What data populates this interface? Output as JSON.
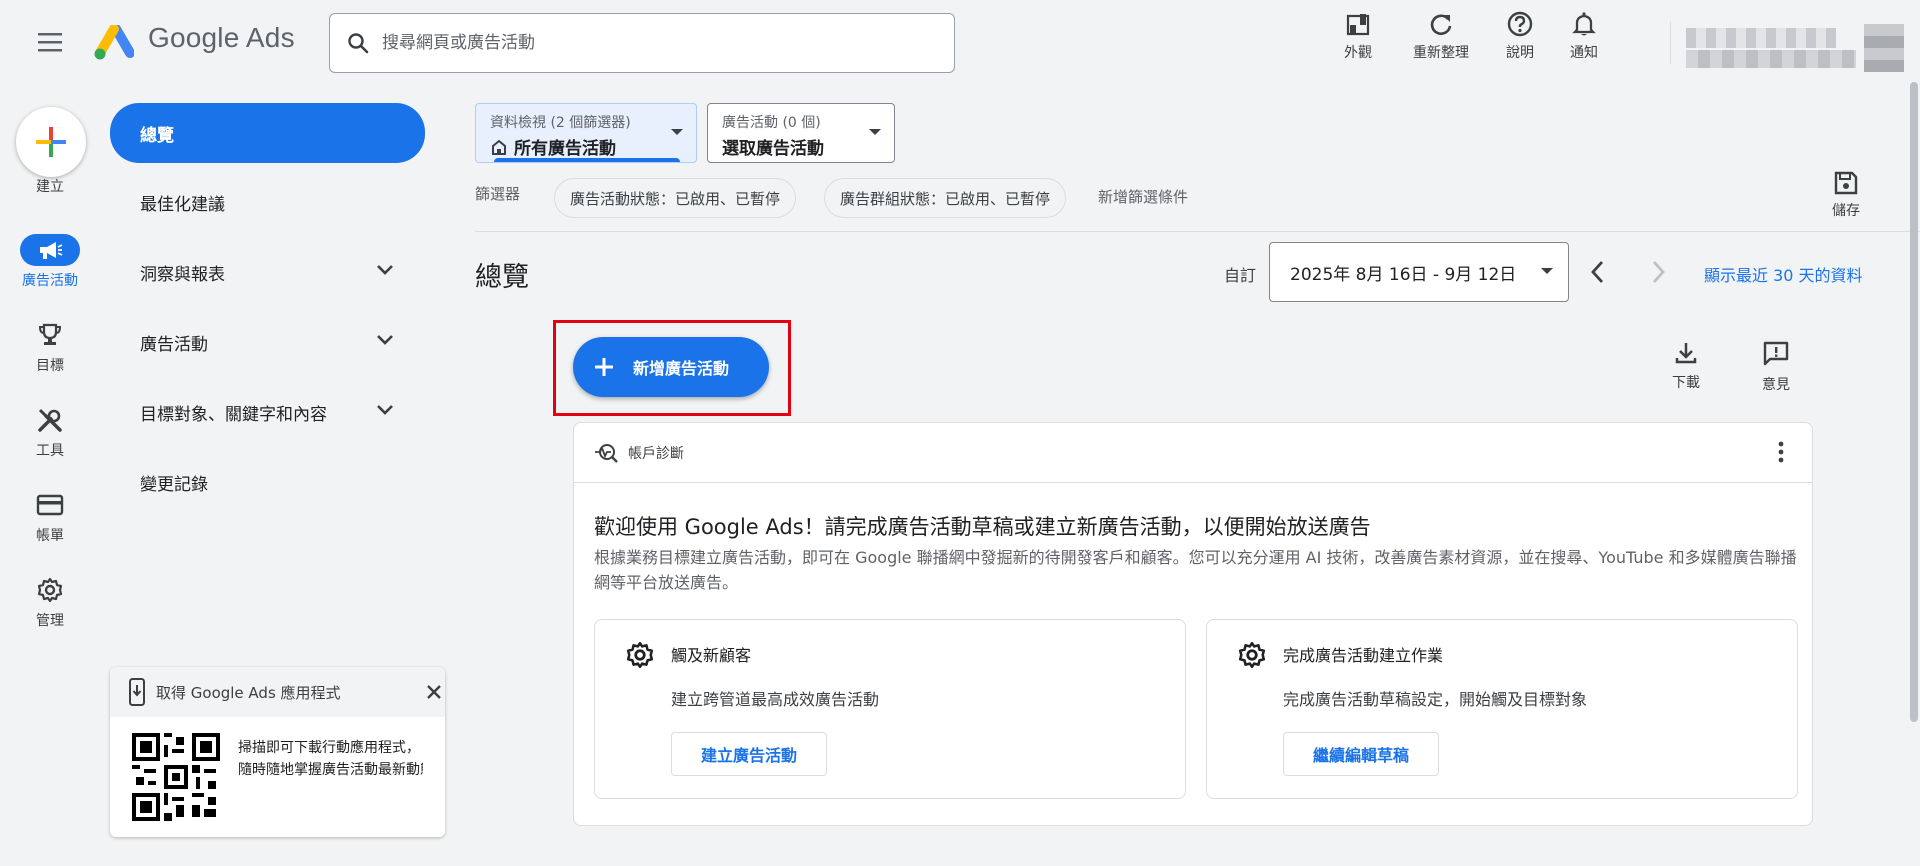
{
  "header": {
    "app_name": "Google Ads",
    "search_placeholder": "搜尋網頁或廣告活動",
    "actions": [
      {
        "label": "外觀",
        "icon": "appearance-icon"
      },
      {
        "label": "重新整理",
        "icon": "refresh-icon"
      },
      {
        "label": "說明",
        "icon": "help-icon"
      },
      {
        "label": "通知",
        "icon": "bell-icon"
      }
    ]
  },
  "rail": {
    "create_label": "建立",
    "items": [
      {
        "label": "廣告活動",
        "icon": "campaign-megaphone-icon",
        "active": true
      },
      {
        "label": "目標",
        "icon": "trophy-icon"
      },
      {
        "label": "工具",
        "icon": "tools-icon"
      },
      {
        "label": "帳單",
        "icon": "credit-card-icon"
      },
      {
        "label": "管理",
        "icon": "gear-icon"
      }
    ]
  },
  "nav": {
    "items": [
      {
        "label": "總覽",
        "active": true
      },
      {
        "label": "最佳化建議"
      },
      {
        "label": "洞察與報表",
        "expandable": true
      },
      {
        "label": "廣告活動",
        "expandable": true
      },
      {
        "label": "目標對象、關鍵字和內容",
        "expandable": true
      },
      {
        "label": "變更記錄"
      }
    ]
  },
  "promo": {
    "title": "取得 Google Ads 應用程式",
    "line1": "掃描即可下載行動應用程式，",
    "line2": "隨時隨地掌握廣告活動最新動態"
  },
  "filters": {
    "view": {
      "small": "資料檢視 (2 個篩選器)",
      "value": "所有廣告活動"
    },
    "campaign": {
      "small": "廣告活動 (0 個)",
      "value": "選取廣告活動"
    },
    "label": "篩選器",
    "chips": [
      "廣告活動狀態：已啟用、已暫停",
      "廣告群組狀態：已啟用、已暫停"
    ],
    "add_filter": "新增篩選條件",
    "save_label": "儲存"
  },
  "overview": {
    "title": "總覽",
    "custom_label": "自訂",
    "date_range": "2025年 8月 16日 - 9月 12日",
    "last_30": "顯示最近 30 天的資料",
    "new_campaign": "新增廣告活動",
    "download": "下載",
    "feedback": "意見"
  },
  "card": {
    "header": "帳戶診斷",
    "title": "歡迎使用 Google Ads！請完成廣告活動草稿或建立新廣告活動，以便開始放送廣告",
    "description": "根據業務目標建立廣告活動，即可在 Google 聯播網中發掘新的待開發客戶和顧客。您可以充分運用 AI 技術，改善廣告素材資源，並在搜尋、YouTube 和多媒體廣告聯播網等平台放送廣告。",
    "subcards": [
      {
        "title": "觸及新顧客",
        "desc": "建立跨管道最高成效廣告活動",
        "button": "建立廣告活動"
      },
      {
        "title": "完成廣告活動建立作業",
        "desc": "完成廣告活動草稿設定，開始觸及目標對象",
        "button": "繼續編輯草稿"
      }
    ]
  },
  "colors": {
    "accent": "#1a73e8",
    "highlight": "#e3000f",
    "background": "#f1f3f4"
  }
}
